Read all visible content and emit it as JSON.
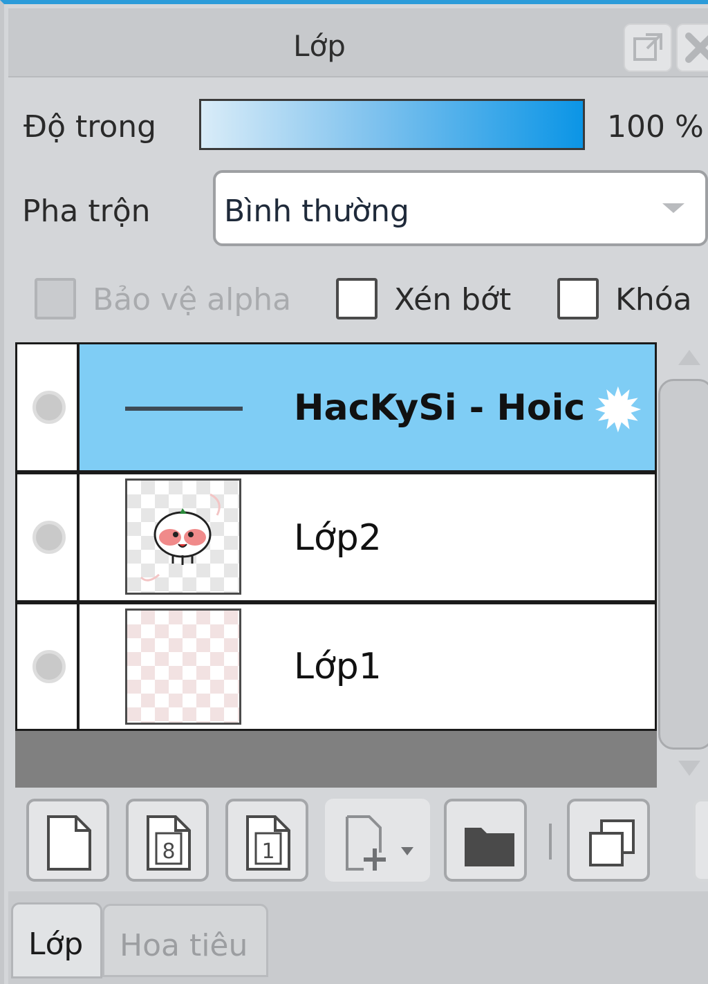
{
  "panel": {
    "title": "Lớp",
    "popout_icon": "popout-icon",
    "close_icon": "close-icon"
  },
  "opacity": {
    "label": "Độ trong",
    "value": "100 %",
    "level_percent": 100
  },
  "blend": {
    "label": "Pha trộn",
    "value": "Bình thường"
  },
  "options": {
    "protect_alpha": {
      "label": "Bảo vệ alpha",
      "checked": false,
      "disabled": true
    },
    "clip": {
      "label": "Xén bớt",
      "checked": false
    },
    "lock": {
      "label": "Khóa",
      "checked": false
    }
  },
  "layers": [
    {
      "name": "HacKySi - Hoic",
      "type": "folder",
      "selected": true,
      "icon": "gear-icon"
    },
    {
      "name": "Lớp2",
      "type": "layer",
      "selected": false
    },
    {
      "name": "Lớp1",
      "type": "layer",
      "selected": false
    }
  ],
  "toolbar": {
    "buttons": [
      "new-layer-icon",
      "new-8bit-layer-icon",
      "new-1bit-layer-icon",
      "add-layer-dropdown-icon",
      "new-folder-icon",
      "duplicate-layer-icon"
    ]
  },
  "tabs": [
    {
      "label": "Lớp",
      "active": true
    },
    {
      "label": "Hoa tiêu",
      "active": false
    }
  ],
  "colors": {
    "accent": "#2b9bd9",
    "selected_row": "#7fcdf5",
    "opacity_start": "#d9ecf8",
    "opacity_end": "#0b95e6"
  }
}
